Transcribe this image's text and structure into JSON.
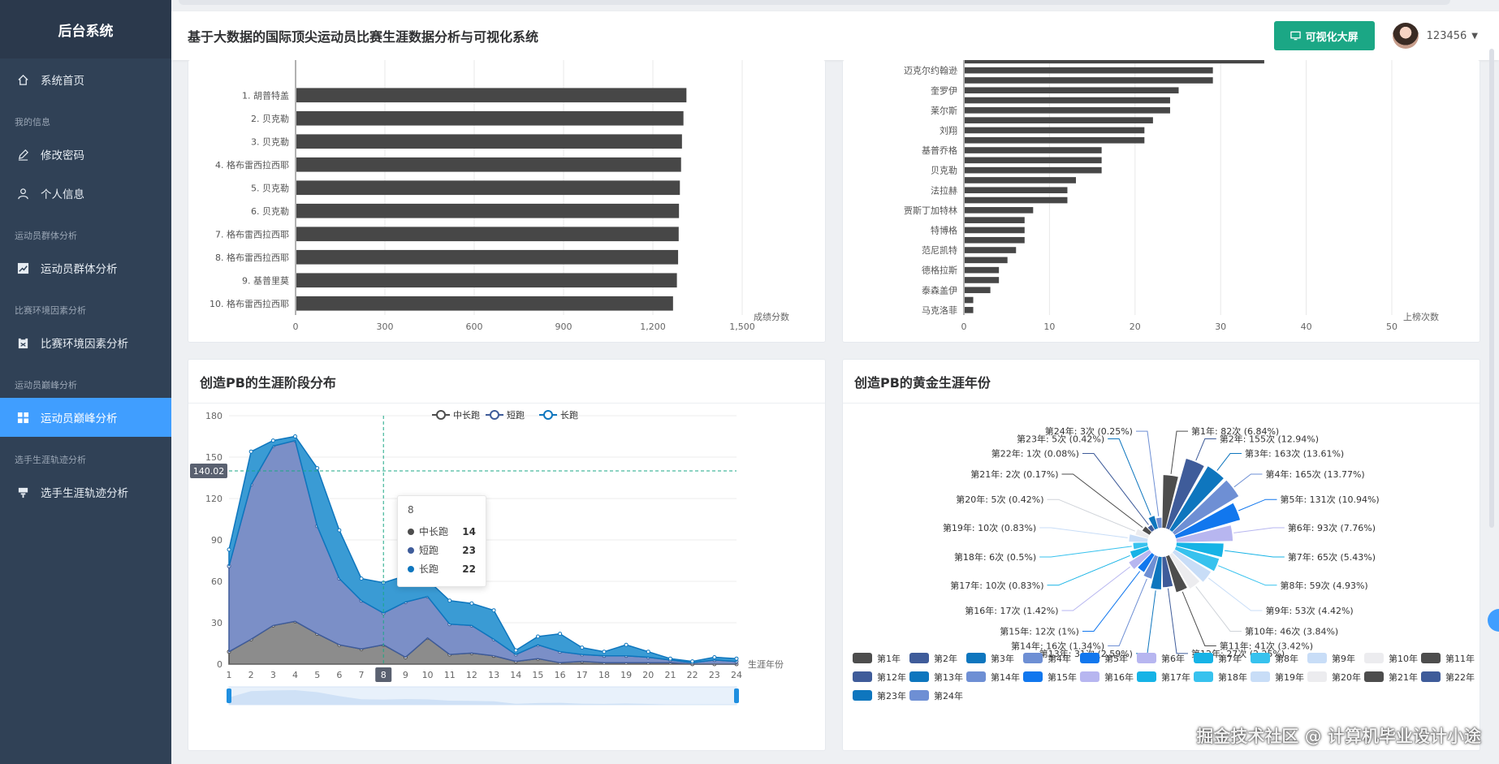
{
  "sidebar": {
    "brand": "后台系统",
    "home": "系统首页",
    "groups": [
      {
        "label": "我的信息",
        "items": [
          "修改密码",
          "个人信息"
        ]
      },
      {
        "label": "运动员群体分析",
        "items": [
          "运动员群体分析"
        ]
      },
      {
        "label": "比赛环境因素分析",
        "items": [
          "比赛环境因素分析"
        ]
      },
      {
        "label": "运动员巅峰分析",
        "items": [
          "运动员巅峰分析"
        ]
      },
      {
        "label": "选手生涯轨迹分析",
        "items": [
          "选手生涯轨迹分析"
        ]
      }
    ],
    "active": "运动员巅峰分析"
  },
  "header": {
    "title": "基于大数据的国际顶尖运动员比赛生涯数据分析与可视化系统",
    "big_screen_button": "可视化大屏",
    "username": "123456"
  },
  "watermark": "掘金技术社区 @ 计算机毕业设计小途",
  "chart_data": [
    {
      "type": "bar",
      "orientation": "horizontal",
      "categories": [
        "1. 胡普特盖",
        "2. 贝克勒",
        "3. 贝克勒",
        "4. 格布雷西拉西耶",
        "5. 贝克勒",
        "6. 贝克勒",
        "7. 格布雷西拉西耶",
        "8. 格布雷西拉西耶",
        "9. 基普里莫",
        "10. 格布雷西拉西耶"
      ],
      "values": [
        1310,
        1300,
        1295,
        1292,
        1288,
        1285,
        1284,
        1282,
        1278,
        1265
      ],
      "xlabel": "成绩分数",
      "xticks": [
        "0",
        "300",
        "600",
        "900",
        "1,200",
        "1,500"
      ],
      "xlim": [
        0,
        1500
      ],
      "grid": true
    },
    {
      "type": "bar",
      "orientation": "horizontal",
      "categories": [
        "",
        "迈克尔约翰逊",
        "",
        "奎罗伊",
        "",
        "莱尔斯",
        "",
        "刘翔",
        "",
        "基普乔格",
        "",
        "贝克勒",
        "",
        "法拉赫",
        "",
        "贾斯丁加特林",
        "",
        "特博格",
        "",
        "范尼凯特",
        "",
        "德格拉斯",
        "",
        "泰森盖伊",
        "",
        "马克洛菲"
      ],
      "values": [
        35,
        29,
        29,
        25,
        24,
        24,
        22,
        21,
        21,
        16,
        16,
        16,
        13,
        12,
        12,
        8,
        7,
        7,
        7,
        6,
        5,
        4,
        4,
        3,
        1,
        1
      ],
      "xlabel": "上榜次数",
      "xticks": [
        "0",
        "10",
        "20",
        "30",
        "40",
        "50"
      ],
      "xlim": [
        0,
        50
      ],
      "grid": true
    },
    {
      "type": "area",
      "title": "创造PB的生涯阶段分布",
      "x": [
        1,
        2,
        3,
        4,
        5,
        6,
        7,
        8,
        9,
        10,
        11,
        12,
        13,
        14,
        15,
        16,
        17,
        18,
        19,
        20,
        21,
        22,
        23,
        24
      ],
      "xlabel": "生涯年份",
      "ylim": [
        0,
        180
      ],
      "yticks": [
        "0",
        "30",
        "60",
        "90",
        "120",
        "150",
        "180"
      ],
      "series": [
        {
          "name": "中长跑",
          "color": "#4d4d4d",
          "values": [
            9,
            18,
            28,
            31,
            22,
            14,
            11,
            14,
            5,
            19,
            7,
            8,
            6,
            2,
            4,
            1,
            2,
            1,
            1,
            1,
            1,
            0,
            0,
            0
          ]
        },
        {
          "name": "短跑",
          "color": "#3f5c9a",
          "values": [
            62,
            112,
            130,
            131,
            78,
            48,
            35,
            23,
            40,
            30,
            22,
            20,
            12,
            5,
            10,
            8,
            5,
            5,
            5,
            4,
            2,
            1,
            3,
            2
          ]
        },
        {
          "name": "长跑",
          "color": "#0e76be",
          "values": [
            12,
            24,
            4,
            3,
            42,
            35,
            16,
            22,
            19,
            12,
            17,
            16,
            21,
            3,
            6,
            13,
            5,
            3,
            8,
            4,
            1,
            1,
            2,
            2
          ]
        }
      ],
      "tooltip": {
        "x": "8",
        "rows": [
          {
            "name": "中长跑",
            "value": "14"
          },
          {
            "name": "短跑",
            "value": "23"
          },
          {
            "name": "长跑",
            "value": "22"
          }
        ]
      },
      "crosshair_y": "140.02",
      "highlight_x": "8",
      "grid": true
    },
    {
      "type": "pie",
      "variant": "rose",
      "title": "创造PB的黄金生涯年份",
      "slices": [
        {
          "label": "第1年",
          "value": 82,
          "pct": "6.84%",
          "color": "#4d4d4d"
        },
        {
          "label": "第2年",
          "value": 155,
          "pct": "12.94%",
          "color": "#3f5c9a"
        },
        {
          "label": "第3年",
          "value": 163,
          "pct": "13.61%",
          "color": "#0e76be"
        },
        {
          "label": "第4年",
          "value": 165,
          "pct": "13.77%",
          "color": "#6e8fd4"
        },
        {
          "label": "第5年",
          "value": 131,
          "pct": "10.94%",
          "color": "#1177ee"
        },
        {
          "label": "第6年",
          "value": 93,
          "pct": "7.76%",
          "color": "#b7b6f0"
        },
        {
          "label": "第7年",
          "value": 65,
          "pct": "5.43%",
          "color": "#16b3e6"
        },
        {
          "label": "第8年",
          "value": 59,
          "pct": "4.93%",
          "color": "#37c2ee"
        },
        {
          "label": "第9年",
          "value": 53,
          "pct": "4.42%",
          "color": "#c8ddf7"
        },
        {
          "label": "第10年",
          "value": 46,
          "pct": "3.84%",
          "color": "#ececef"
        },
        {
          "label": "第11年",
          "value": 41,
          "pct": "3.42%",
          "color": "#4d4d4d"
        },
        {
          "label": "第12年",
          "value": 27,
          "pct": "2.25%",
          "color": "#3f5c9a"
        },
        {
          "label": "第13年",
          "value": 31,
          "pct": "2.59%",
          "color": "#0e76be"
        },
        {
          "label": "第14年",
          "value": 16,
          "pct": "1.34%",
          "color": "#6e8fd4"
        },
        {
          "label": "第15年",
          "value": 12,
          "pct": "1%",
          "color": "#1177ee"
        },
        {
          "label": "第16年",
          "value": 17,
          "pct": "1.42%",
          "color": "#b7b6f0"
        },
        {
          "label": "第17年",
          "value": 10,
          "pct": "0.83%",
          "color": "#16b3e6"
        },
        {
          "label": "第18年",
          "value": 6,
          "pct": "0.5%",
          "color": "#37c2ee"
        },
        {
          "label": "第19年",
          "value": 10,
          "pct": "0.83%",
          "color": "#c8ddf7"
        },
        {
          "label": "第20年",
          "value": 5,
          "pct": "0.42%",
          "color": "#ececef"
        },
        {
          "label": "第21年",
          "value": 2,
          "pct": "0.17%",
          "color": "#4d4d4d"
        },
        {
          "label": "第22年",
          "value": 1,
          "pct": "0.08%",
          "color": "#3f5c9a"
        },
        {
          "label": "第23年",
          "value": 5,
          "pct": "0.42%",
          "color": "#0e76be"
        },
        {
          "label": "第24年",
          "value": 3,
          "pct": "0.25%",
          "color": "#6e8fd4"
        }
      ]
    }
  ]
}
